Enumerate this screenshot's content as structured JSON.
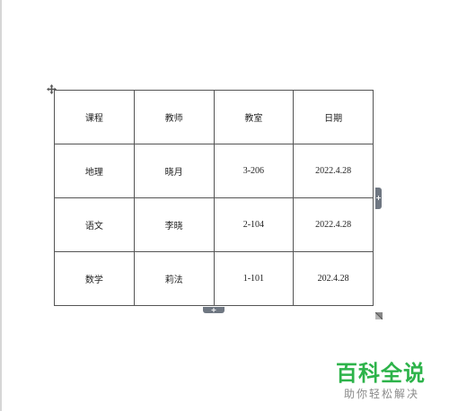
{
  "table": {
    "header": [
      "课程",
      "教师",
      "教室",
      "日期"
    ],
    "rows": [
      [
        "地理",
        "晓月",
        "3-206",
        "2022.4.28"
      ],
      [
        "语文",
        "李晓",
        "2-104",
        "2022.4.28"
      ],
      [
        "数学",
        "莉法",
        "1-101",
        "202.4.28"
      ]
    ]
  },
  "handles": {
    "add_symbol": "+"
  },
  "watermark": {
    "title": "百科全说",
    "subtitle": "助你轻松解决"
  },
  "icons": {
    "move": "move-cross-arrows-icon",
    "resize": "resize-corner-icon"
  },
  "colors": {
    "watermark_green": "#2db34a",
    "tab_gray": "#6f7782",
    "border": "#555555"
  }
}
